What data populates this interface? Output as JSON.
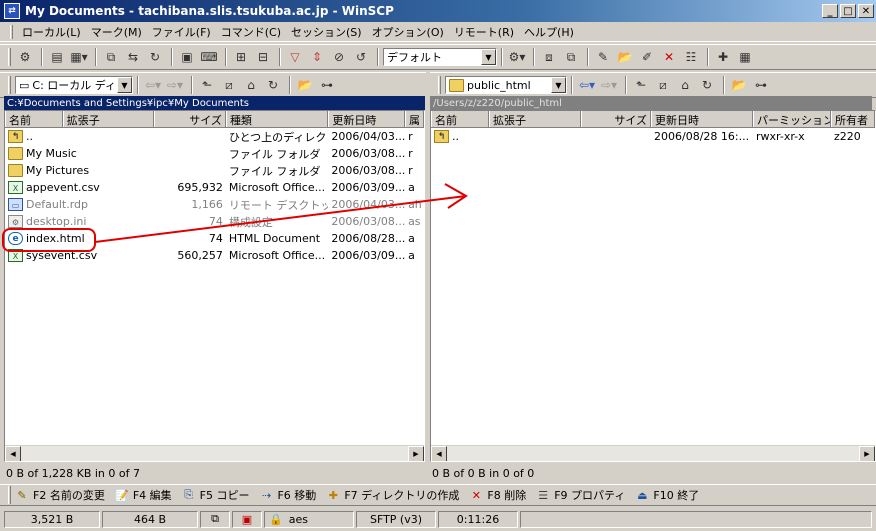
{
  "window": {
    "title": "My Documents - tachibana.slis.tsukuba.ac.jp - WinSCP"
  },
  "menu": [
    "ローカル(L)",
    "マーク(M)",
    "ファイル(F)",
    "コマンド(C)",
    "セッション(S)",
    "オプション(O)",
    "リモート(R)",
    "ヘルプ(H)"
  ],
  "toolbar": {
    "profile": "デフォルト"
  },
  "local": {
    "drive": "C: ローカル ディス",
    "path": "C:¥Documents and Settings¥ipc¥My Documents",
    "columns": [
      "名前",
      "拡張子",
      "サイズ",
      "種類",
      "更新日時",
      "属"
    ],
    "rows": [
      {
        "name": "..",
        "size": "",
        "type": "ひとつ上のディレクト",
        "date": "2006/04/03...",
        "attr": "r",
        "icon": "up-icon"
      },
      {
        "name": "My Music",
        "size": "",
        "type": "ファイル フォルダ",
        "date": "2006/03/08...",
        "attr": "r",
        "icon": "folder-icon"
      },
      {
        "name": "My Pictures",
        "size": "",
        "type": "ファイル フォルダ",
        "date": "2006/03/08...",
        "attr": "r",
        "icon": "folder-icon"
      },
      {
        "name": "appevent.csv",
        "size": "695,932",
        "type": "Microsoft Office...",
        "date": "2006/03/09...",
        "attr": "a",
        "icon": "csv-icon"
      },
      {
        "name": "Default.rdp",
        "size": "1,166",
        "type": "リモート デスクトッ...",
        "date": "2006/04/03...",
        "attr": "ah",
        "icon": "rdp-icon"
      },
      {
        "name": "desktop.ini",
        "size": "74",
        "type": "構成設定",
        "date": "2006/03/08...",
        "attr": "as",
        "icon": "ini-icon"
      },
      {
        "name": "index.html",
        "size": "74",
        "type": "HTML Document",
        "date": "2006/08/28...",
        "attr": "a",
        "icon": "html-icon"
      },
      {
        "name": "sysevent.csv",
        "size": "560,257",
        "type": "Microsoft Office...",
        "date": "2006/03/09...",
        "attr": "a",
        "icon": "csv-icon"
      }
    ],
    "status": "0 B of 1,228 KB in 0 of 7"
  },
  "remote": {
    "folder": "public_html",
    "path": "/Users/z/z220/public_html",
    "columns": [
      "名前",
      "拡張子",
      "サイズ",
      "更新日時",
      "パーミッション",
      "所有者"
    ],
    "rows": [
      {
        "name": "..",
        "size": "",
        "date": "2006/08/28 16:...",
        "perm": "rwxr-xr-x",
        "owner": "z220"
      }
    ],
    "status": "0 B of 0 B in 0 of 0"
  },
  "fkeys": [
    {
      "label": "F2 名前の変更",
      "icon": "rename-icon",
      "glyph": "✎"
    },
    {
      "label": "F4 編集",
      "icon": "edit-icon",
      "glyph": "📝"
    },
    {
      "label": "F5 コピー",
      "icon": "copy-icon",
      "glyph": "⎘"
    },
    {
      "label": "F6 移動",
      "icon": "move-icon",
      "glyph": "⇢"
    },
    {
      "label": "F7 ディレクトリの作成",
      "icon": "new-folder-icon",
      "glyph": "✚"
    },
    {
      "label": "F8 削除",
      "icon": "delete-icon",
      "glyph": "✕"
    },
    {
      "label": "F9 プロパティ",
      "icon": "properties-icon",
      "glyph": "☰"
    },
    {
      "label": "F10 終了",
      "icon": "exit-icon",
      "glyph": "⏏"
    }
  ],
  "statusbar": {
    "sent": "3,521 B",
    "received": "464 B",
    "cipher": "aes",
    "protocol": "SFTP (v3)",
    "time": "0:11:26"
  },
  "colors": {
    "annotation": "#e00000",
    "title_active": "#0a246a",
    "path_active": "#0a246a",
    "path_inactive": "#808080"
  }
}
